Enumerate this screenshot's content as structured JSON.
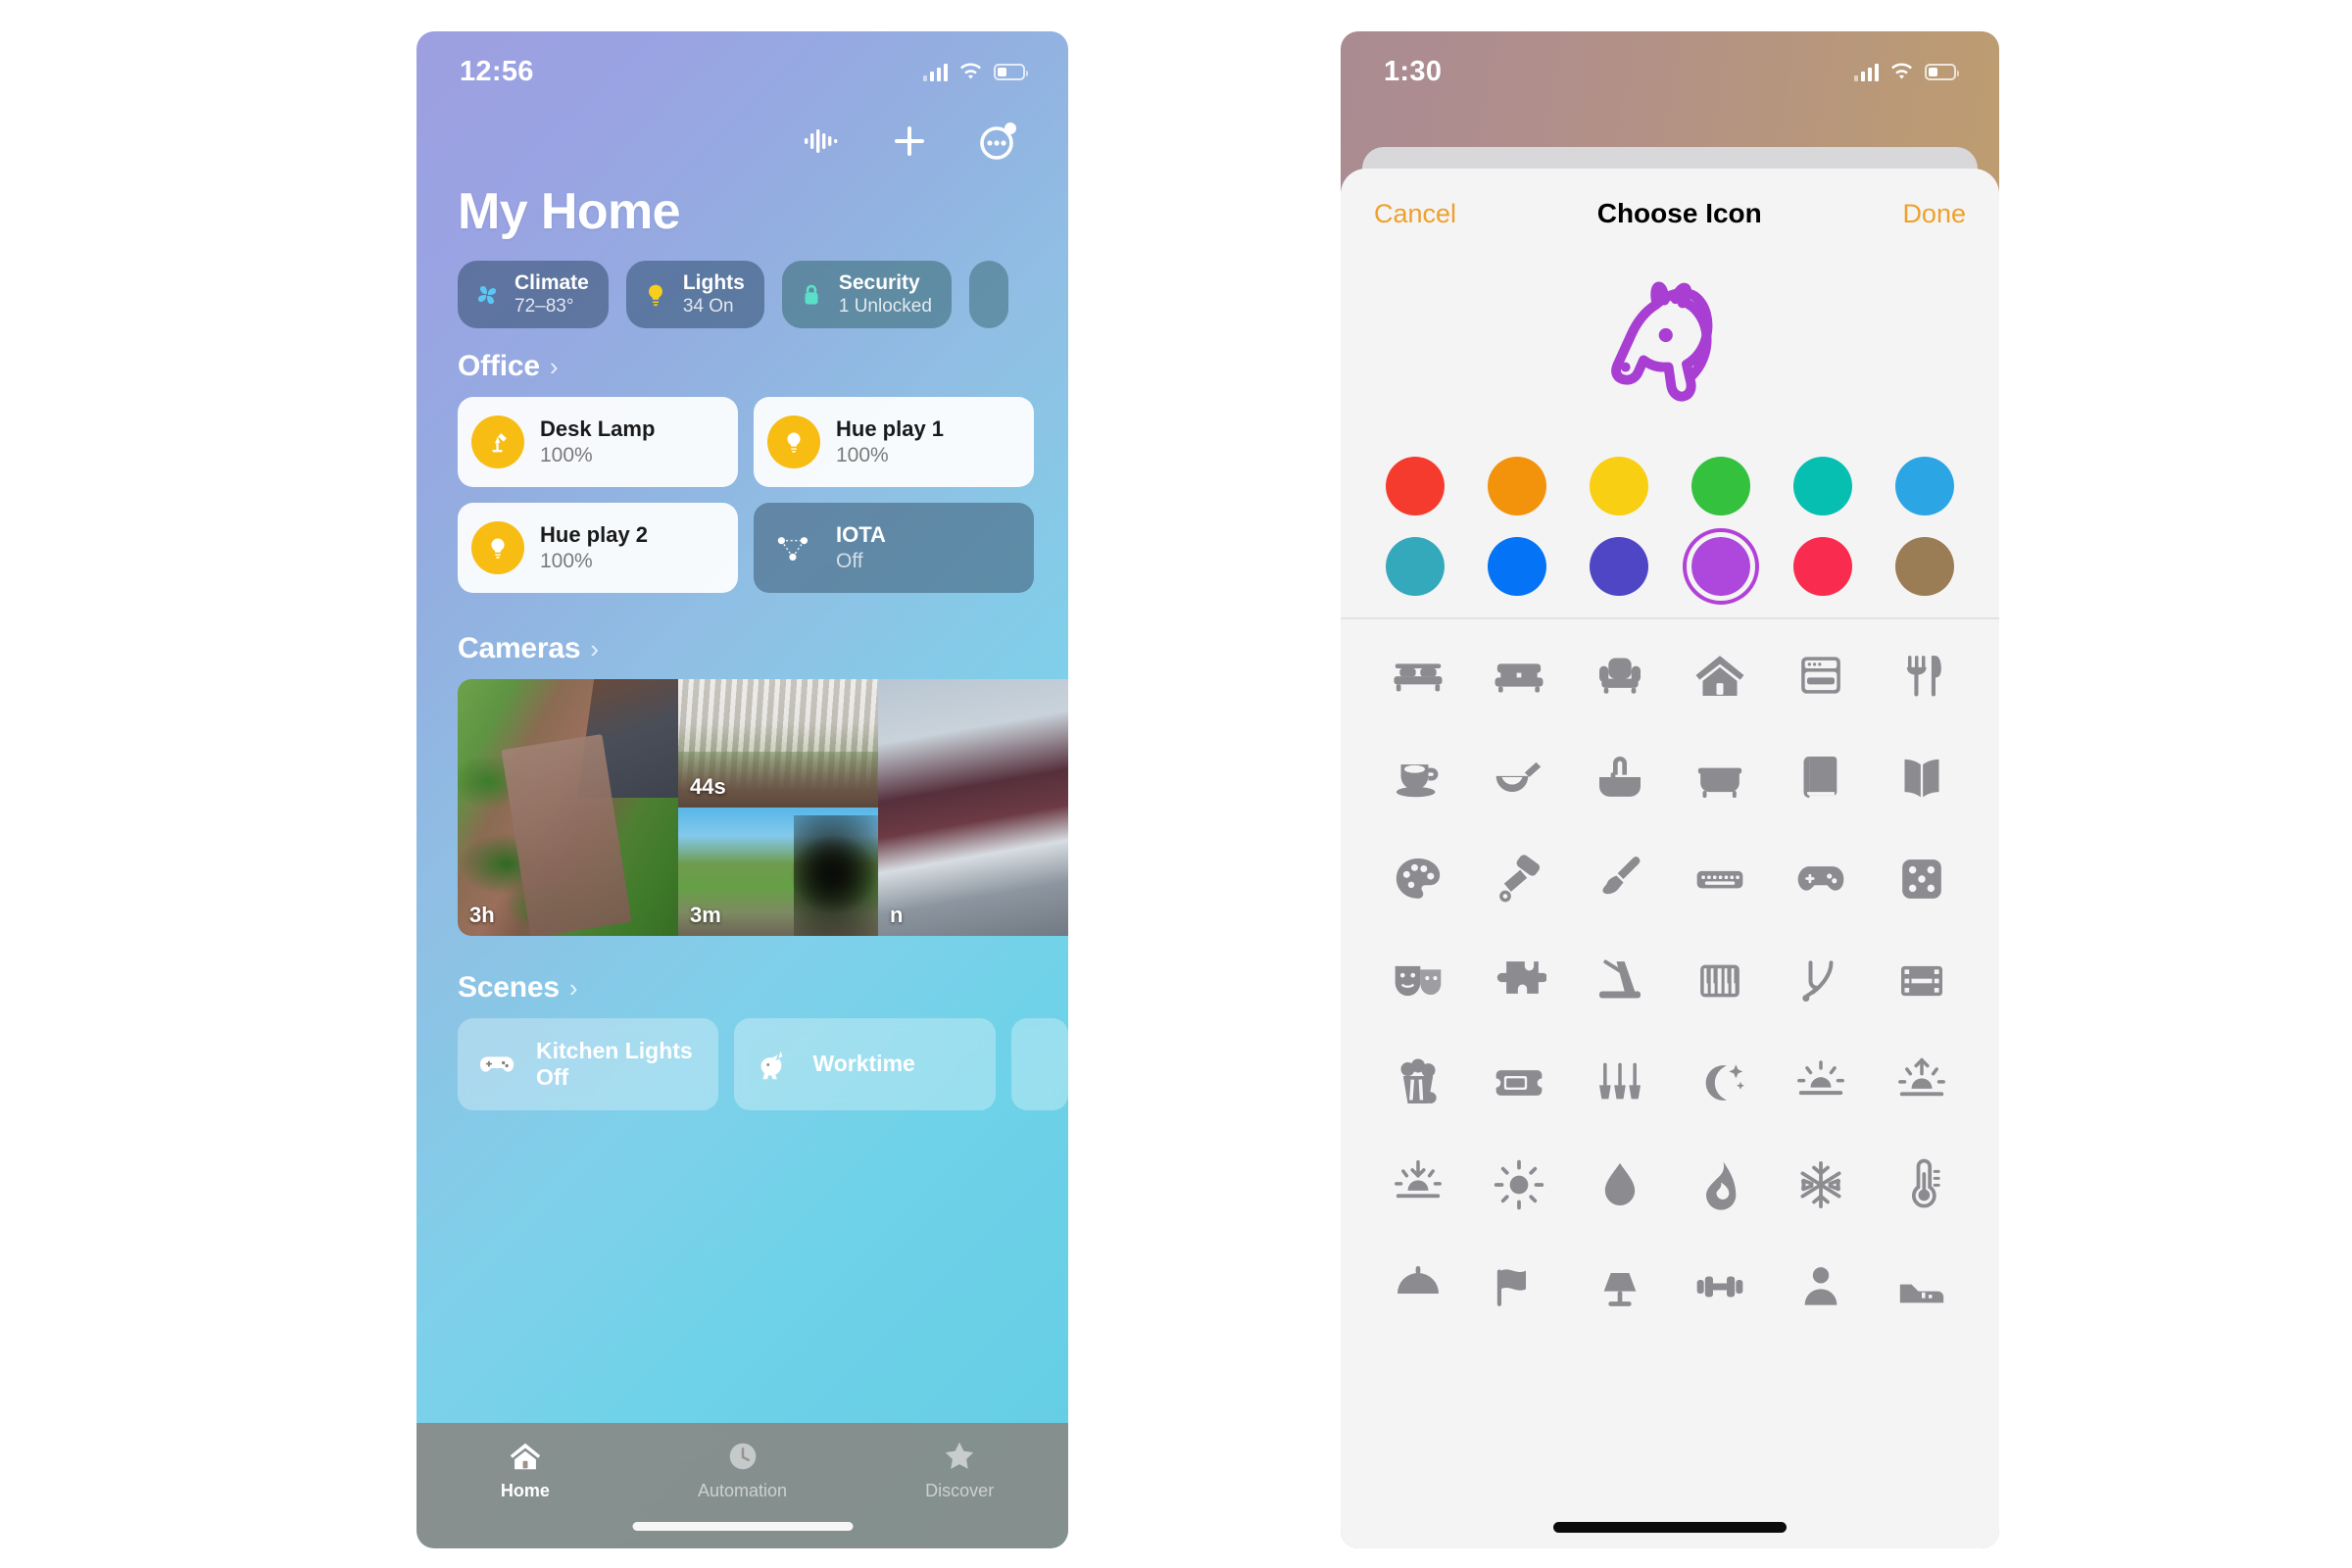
{
  "home_screen": {
    "status_bar": {
      "time": "12:56",
      "signal_icon": "cellular-bars-icon",
      "wifi_icon": "wifi-icon",
      "battery_icon": "battery-icon"
    },
    "header_actions": [
      {
        "name": "siri-waveform-icon",
        "label": "Siri"
      },
      {
        "name": "add-icon",
        "label": "Add"
      },
      {
        "name": "more-options-icon",
        "label": "More"
      }
    ],
    "title": "My Home",
    "status_chips": [
      {
        "name": "Climate",
        "sub": "72–83°",
        "icon": "fan-icon",
        "icon_color": "#5ac8f5",
        "bg": "rgba(60,85,120,.62)"
      },
      {
        "name": "Lights",
        "sub": "34 On",
        "icon": "lightbulb-icon",
        "icon_color": "#F7CE1B",
        "bg": "rgba(58,88,122,.62)"
      },
      {
        "name": "Security",
        "sub": "1 Unlocked",
        "icon": "lock-icon",
        "icon_color": "#5ae0c8",
        "bg": "rgba(62,110,122,.60)"
      }
    ],
    "sections": {
      "office": {
        "label": "Office",
        "chevron": "›"
      },
      "cameras": {
        "label": "Cameras",
        "chevron": "›"
      },
      "scenes": {
        "label": "Scenes",
        "chevron": "›"
      }
    },
    "devices": [
      {
        "name": "Desk Lamp",
        "state": "100%",
        "on": true,
        "icon": "desk-lamp-icon"
      },
      {
        "name": "Hue play 1",
        "state": "100%",
        "on": true,
        "icon": "lightbulb-icon"
      },
      {
        "name": "Hue play 2",
        "state": "100%",
        "on": true,
        "icon": "lightbulb-icon"
      },
      {
        "name": "IOTA",
        "state": "Off",
        "on": false,
        "icon": "sensor-network-icon"
      }
    ],
    "cameras": [
      {
        "id": "cam-garden",
        "timestamp": "3h",
        "art": "art-garden"
      },
      {
        "id": "cam-porch",
        "timestamp": "44s",
        "art": "art-porch"
      },
      {
        "id": "cam-yard",
        "timestamp": "3m",
        "art": "art-yard"
      },
      {
        "id": "cam-edge",
        "timestamp": "n",
        "art": "art-room"
      }
    ],
    "scenes": [
      {
        "label": "Kitchen Lights Off",
        "icon": "gamecontroller-icon"
      },
      {
        "label": "Worktime",
        "icon": "unicorn-icon"
      }
    ],
    "tabs": [
      {
        "label": "Home",
        "icon": "house-icon",
        "active": true
      },
      {
        "label": "Automation",
        "icon": "clock-icon",
        "active": false
      },
      {
        "label": "Discover",
        "icon": "star-icon",
        "active": false
      }
    ]
  },
  "icon_picker": {
    "status_bar": {
      "time": "1:30",
      "signal_icon": "cellular-bars-icon",
      "wifi_icon": "wifi-icon",
      "battery_icon": "battery-icon"
    },
    "nav": {
      "cancel": "Cancel",
      "title": "Choose Icon",
      "done": "Done",
      "accent": "#f0a02a"
    },
    "preview": {
      "icon": "horse-head-icon",
      "color": "#a83fd2"
    },
    "color_rows": [
      [
        {
          "name": "red",
          "hex": "#F43B2E"
        },
        {
          "name": "orange",
          "hex": "#F2930B"
        },
        {
          "name": "yellow",
          "hex": "#F8CF12"
        },
        {
          "name": "green",
          "hex": "#34C13E"
        },
        {
          "name": "teal",
          "hex": "#06BFB0"
        },
        {
          "name": "light-blue",
          "hex": "#2CA5E4"
        }
      ],
      [
        {
          "name": "cyan",
          "hex": "#35A9BC"
        },
        {
          "name": "blue",
          "hex": "#0573F5"
        },
        {
          "name": "indigo",
          "hex": "#4E46C4"
        },
        {
          "name": "purple",
          "hex": "#AE47DB",
          "selected": true
        },
        {
          "name": "pink",
          "hex": "#F92C4F"
        },
        {
          "name": "brown",
          "hex": "#9B7D55"
        }
      ]
    ],
    "icon_rows": [
      [
        "bed-icon",
        "sofa-icon",
        "armchair-icon",
        "house-icon",
        "oven-icon",
        "fork-knife-icon"
      ],
      [
        "teacup-icon",
        "pan-icon",
        "sink-icon",
        "bathtub-icon",
        "book-closed-icon",
        "book-open-icon"
      ],
      [
        "palette-icon",
        "paint-roller-icon",
        "paintbrush-icon",
        "keyboard-icon",
        "gamecontroller-icon",
        "dice-icon"
      ],
      [
        "theater-masks-icon",
        "puzzle-piece-icon",
        "metronome-icon",
        "piano-icon",
        "tuning-fork-icon",
        "film-icon"
      ],
      [
        "popcorn-icon",
        "ticket-icon",
        "garden-tools-icon",
        "moon-stars-icon",
        "sunrise-icon",
        "sun-up-icon"
      ],
      [
        "sunset-icon",
        "sun-icon",
        "drop-icon",
        "flame-icon",
        "snowflake-icon",
        "thermometer-icon"
      ],
      [
        "dome-icon",
        "flag-icon",
        "lamp-icon",
        "dumbbell-icon",
        "person-icon",
        "shoe-icon"
      ]
    ]
  }
}
